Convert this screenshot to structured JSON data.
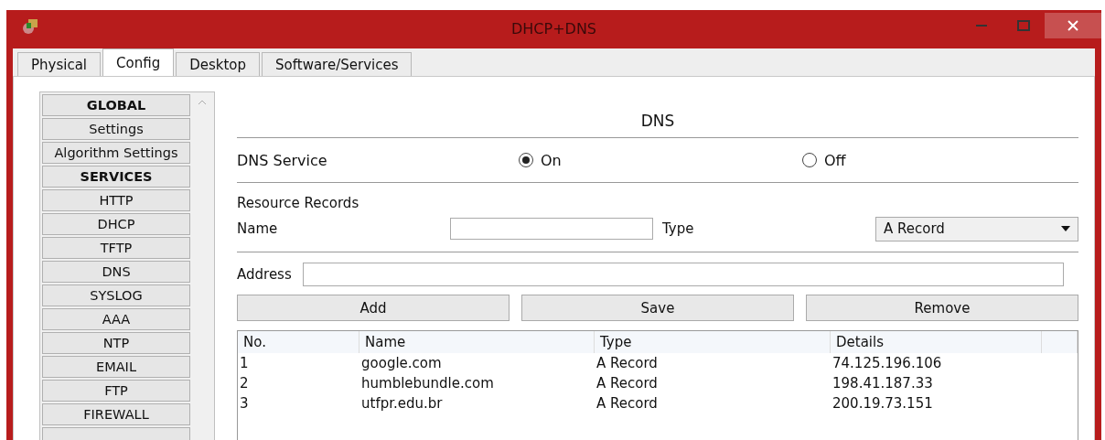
{
  "window": {
    "title": "DHCP+DNS"
  },
  "tabs": [
    {
      "label": "Physical",
      "selected": false
    },
    {
      "label": "Config",
      "selected": true
    },
    {
      "label": "Desktop",
      "selected": false
    },
    {
      "label": "Software/Services",
      "selected": false
    }
  ],
  "sidebar": {
    "items": [
      {
        "label": "GLOBAL",
        "kind": "header"
      },
      {
        "label": "Settings",
        "kind": "item"
      },
      {
        "label": "Algorithm Settings",
        "kind": "item"
      },
      {
        "label": "SERVICES",
        "kind": "header"
      },
      {
        "label": "HTTP",
        "kind": "item"
      },
      {
        "label": "DHCP",
        "kind": "item"
      },
      {
        "label": "TFTP",
        "kind": "item"
      },
      {
        "label": "DNS",
        "kind": "item"
      },
      {
        "label": "SYSLOG",
        "kind": "item"
      },
      {
        "label": "AAA",
        "kind": "item"
      },
      {
        "label": "NTP",
        "kind": "item"
      },
      {
        "label": "EMAIL",
        "kind": "item"
      },
      {
        "label": "FTP",
        "kind": "item"
      },
      {
        "label": "FIREWALL",
        "kind": "item"
      }
    ]
  },
  "panel": {
    "title": "DNS",
    "dns_service": {
      "label": "DNS Service",
      "options": [
        {
          "label": "On",
          "selected": true
        },
        {
          "label": "Off",
          "selected": false
        }
      ]
    },
    "resource_records": {
      "label": "Resource Records",
      "name_label": "Name",
      "type_label": "Type",
      "type_value": "A Record",
      "address_label": "Address"
    },
    "buttons": [
      "Add",
      "Save",
      "Remove"
    ],
    "table": {
      "columns": [
        "No.",
        "Name",
        "Type",
        "Details"
      ],
      "rows": [
        [
          "1",
          "google.com",
          "A Record",
          "74.125.196.106"
        ],
        [
          "2",
          "humblebundle.com",
          "A Record",
          "198.41.187.33"
        ],
        [
          "3",
          "utfpr.edu.br",
          "A Record",
          "200.19.73.151"
        ]
      ]
    }
  }
}
